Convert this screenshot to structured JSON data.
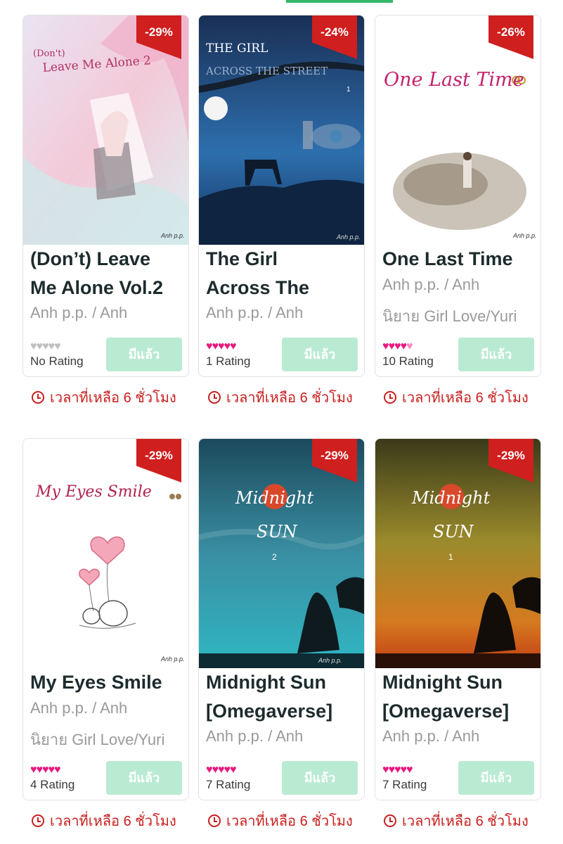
{
  "timer_text": "เวลาที่เหลือ 6 ชั่วโมง",
  "owned_label": "มีแล้ว",
  "colors": {
    "accent_green": "#35b86b",
    "discount_red": "#cf1f1f",
    "heart_pink": "#e8197f",
    "timer_red": "#c8201f"
  },
  "books": [
    {
      "discount": "-29%",
      "title_l1": "(Don’t) Leave",
      "title_l2": "Me Alone Vol.2",
      "meta1": "Anh p.p. / Anh",
      "meta2": "",
      "rating_text": "No Rating",
      "hearts_filled": 0,
      "cover_text_a": "(Don't)",
      "cover_text_b": "Leave Me Alone 2",
      "cover_sign": "Anh p.p."
    },
    {
      "discount": "-24%",
      "title_l1": "The Girl",
      "title_l2": "Across The",
      "meta1": "Anh p.p. / Anh",
      "meta2": "",
      "rating_text": "1 Rating",
      "hearts_filled": 5,
      "cover_text_a": "THE GIRL",
      "cover_text_b": "ACROSS THE STREET",
      "cover_num": "1",
      "cover_sign": "Anh p.p."
    },
    {
      "discount": "-26%",
      "title_l1": "One Last Time",
      "title_l2": "",
      "meta1": "Anh p.p. / Anh",
      "meta2": "นิยาย Girl Love/Yuri",
      "rating_text": "10 Rating",
      "hearts_filled": 4.5,
      "cover_text_a": "One Last Time",
      "cover_sign": "Anh p.p."
    },
    {
      "discount": "-29%",
      "title_l1": "My Eyes Smile",
      "title_l2": "",
      "meta1": "Anh p.p. / Anh",
      "meta2": "นิยาย Girl Love/Yuri",
      "rating_text": "4 Rating",
      "hearts_filled": 5,
      "cover_text_a": "My Eyes Smile",
      "cover_sign": "Anh p.p."
    },
    {
      "discount": "-29%",
      "title_l1": "Midnight Sun",
      "title_l2": "[Omegaverse]",
      "meta1": "Anh p.p. / Anh",
      "meta2": "",
      "rating_text": "7 Rating",
      "hearts_filled": 5,
      "cover_text_a": "Midnight",
      "cover_text_b": "SUN",
      "cover_num": "2",
      "cover_sign": "Anh p.p."
    },
    {
      "discount": "-29%",
      "title_l1": "Midnight Sun",
      "title_l2": "[Omegaverse]",
      "meta1": "Anh p.p. / Anh",
      "meta2": "",
      "rating_text": "7 Rating",
      "hearts_filled": 5,
      "cover_text_a": "Midnight",
      "cover_text_b": "SUN",
      "cover_num": "1"
    }
  ]
}
